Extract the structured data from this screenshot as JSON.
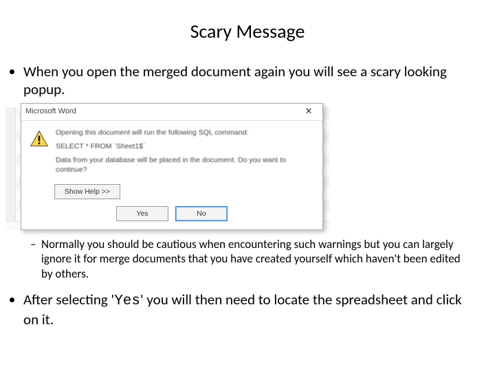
{
  "title": "Scary Message",
  "bullets": {
    "b1": "When you open the merged document again you will see a scary looking popup.",
    "b1_sub": "Normally you should be cautious when encountering such warnings but you can largely ignore it for merge documents that you have created yourself which haven't been edited by others.",
    "b2_pre": "After selecting '",
    "b2_mono": "Yes",
    "b2_post": "' you will then need to locate the spreadsheet and click on it."
  },
  "dialog": {
    "app": "Microsoft Word",
    "close": "✕",
    "line1": "Opening this document will run the following SQL command:",
    "line2": "SELECT * FROM `Sheet1$`",
    "line3": "Data from your database will be placed in the document. Do you want to continue?",
    "help": "Show Help >>",
    "yes": "Yes",
    "no": "No"
  }
}
